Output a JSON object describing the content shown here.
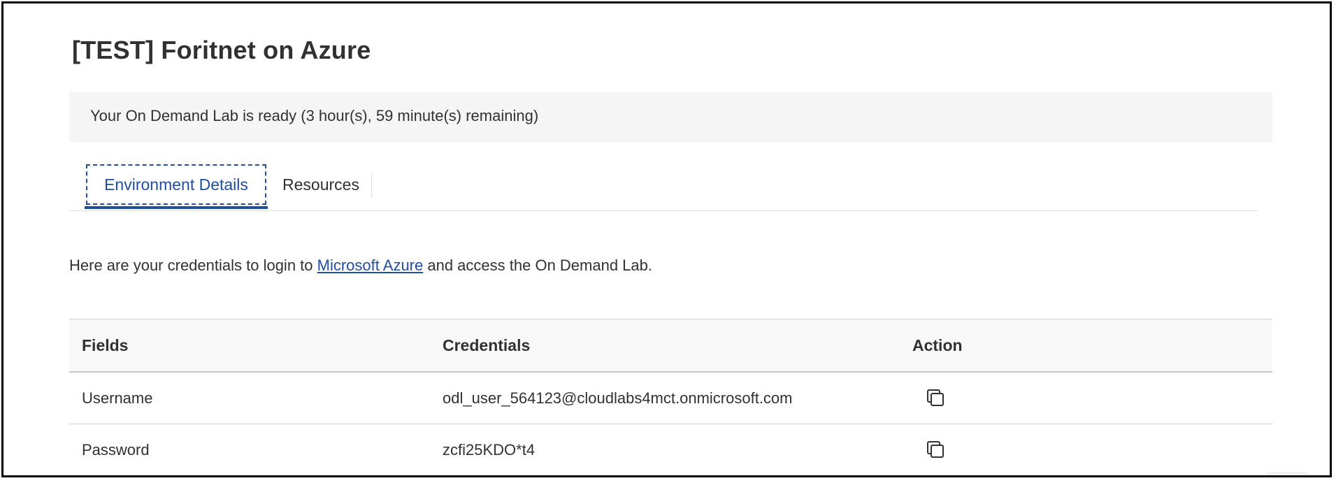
{
  "page": {
    "title": "[TEST] Foritnet on Azure"
  },
  "banner": {
    "status_text": "Your On Demand Lab is ready (3 hour(s), 59 minute(s) remaining)"
  },
  "tabs": [
    {
      "label": "Environment Details",
      "active": true
    },
    {
      "label": "Resources",
      "active": false
    }
  ],
  "intro": {
    "prefix": "Here are your credentials to login to ",
    "link_text": "Microsoft Azure",
    "suffix": " and access the On Demand Lab."
  },
  "table": {
    "headers": [
      "Fields",
      "Credentials",
      "Action"
    ],
    "rows": [
      {
        "field": "Username",
        "credential": "odl_user_564123@cloudlabs4mct.onmicrosoft.com",
        "action_icon": "copy-icon"
      },
      {
        "field": "Password",
        "credential": "zcfi25KDO*t4",
        "action_icon": "copy-icon"
      }
    ]
  },
  "colors": {
    "accent": "#1f4e9e",
    "banner_bg": "#f5f5f5",
    "text": "#323130"
  }
}
